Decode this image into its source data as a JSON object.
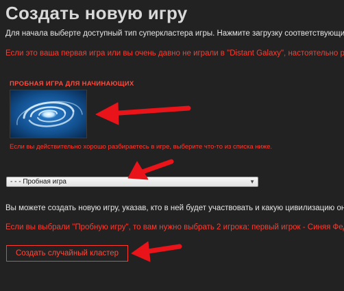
{
  "page": {
    "title": "Создать новую игру",
    "intro": "Для начала выберте доступный тип суперкластера игры. Нажмите загрузку соответствующих н",
    "warning": "Если это ваша первая игра или вы очень давно не играли в \"Distant Galaxy\", настоятельно рек"
  },
  "trial": {
    "heading": "ПРОБНАЯ ИГРА ДЛЯ НАЧИНАЮЩИХ",
    "hint": "Если вы действительно хорошо разбираетесь в игре, выберите что-то из списка ниже."
  },
  "cluster_select": {
    "selected": "- - - Пробная игра"
  },
  "players": {
    "info": "Вы можете создать новую игру, указав, кто в ней будет участвовать и какую цивилизацию они в",
    "note": "Если вы выбрали \"Пробную игру\", то вам нужно выбрать 2 игрока: первый игрок - Синяя Феде"
  },
  "actions": {
    "create_random": "Создать случайный кластер"
  },
  "colors": {
    "background": "#222222",
    "accent_red": "#ff3b30",
    "arrow_red": "#e8141a"
  }
}
